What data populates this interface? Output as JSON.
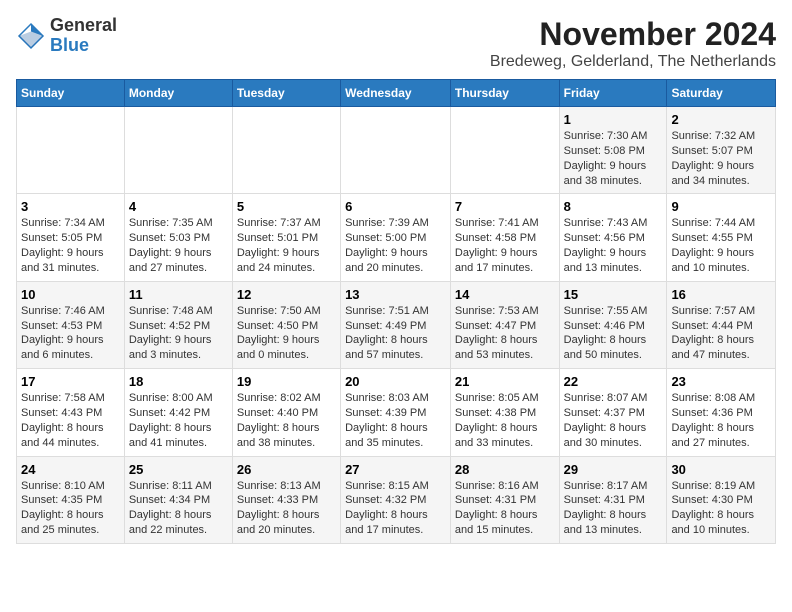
{
  "logo": {
    "general": "General",
    "blue": "Blue"
  },
  "title": "November 2024",
  "location": "Bredeweg, Gelderland, The Netherlands",
  "days_header": [
    "Sunday",
    "Monday",
    "Tuesday",
    "Wednesday",
    "Thursday",
    "Friday",
    "Saturday"
  ],
  "weeks": [
    [
      {
        "day": "",
        "info": ""
      },
      {
        "day": "",
        "info": ""
      },
      {
        "day": "",
        "info": ""
      },
      {
        "day": "",
        "info": ""
      },
      {
        "day": "",
        "info": ""
      },
      {
        "day": "1",
        "info": "Sunrise: 7:30 AM\nSunset: 5:08 PM\nDaylight: 9 hours and 38 minutes."
      },
      {
        "day": "2",
        "info": "Sunrise: 7:32 AM\nSunset: 5:07 PM\nDaylight: 9 hours and 34 minutes."
      }
    ],
    [
      {
        "day": "3",
        "info": "Sunrise: 7:34 AM\nSunset: 5:05 PM\nDaylight: 9 hours and 31 minutes."
      },
      {
        "day": "4",
        "info": "Sunrise: 7:35 AM\nSunset: 5:03 PM\nDaylight: 9 hours and 27 minutes."
      },
      {
        "day": "5",
        "info": "Sunrise: 7:37 AM\nSunset: 5:01 PM\nDaylight: 9 hours and 24 minutes."
      },
      {
        "day": "6",
        "info": "Sunrise: 7:39 AM\nSunset: 5:00 PM\nDaylight: 9 hours and 20 minutes."
      },
      {
        "day": "7",
        "info": "Sunrise: 7:41 AM\nSunset: 4:58 PM\nDaylight: 9 hours and 17 minutes."
      },
      {
        "day": "8",
        "info": "Sunrise: 7:43 AM\nSunset: 4:56 PM\nDaylight: 9 hours and 13 minutes."
      },
      {
        "day": "9",
        "info": "Sunrise: 7:44 AM\nSunset: 4:55 PM\nDaylight: 9 hours and 10 minutes."
      }
    ],
    [
      {
        "day": "10",
        "info": "Sunrise: 7:46 AM\nSunset: 4:53 PM\nDaylight: 9 hours and 6 minutes."
      },
      {
        "day": "11",
        "info": "Sunrise: 7:48 AM\nSunset: 4:52 PM\nDaylight: 9 hours and 3 minutes."
      },
      {
        "day": "12",
        "info": "Sunrise: 7:50 AM\nSunset: 4:50 PM\nDaylight: 9 hours and 0 minutes."
      },
      {
        "day": "13",
        "info": "Sunrise: 7:51 AM\nSunset: 4:49 PM\nDaylight: 8 hours and 57 minutes."
      },
      {
        "day": "14",
        "info": "Sunrise: 7:53 AM\nSunset: 4:47 PM\nDaylight: 8 hours and 53 minutes."
      },
      {
        "day": "15",
        "info": "Sunrise: 7:55 AM\nSunset: 4:46 PM\nDaylight: 8 hours and 50 minutes."
      },
      {
        "day": "16",
        "info": "Sunrise: 7:57 AM\nSunset: 4:44 PM\nDaylight: 8 hours and 47 minutes."
      }
    ],
    [
      {
        "day": "17",
        "info": "Sunrise: 7:58 AM\nSunset: 4:43 PM\nDaylight: 8 hours and 44 minutes."
      },
      {
        "day": "18",
        "info": "Sunrise: 8:00 AM\nSunset: 4:42 PM\nDaylight: 8 hours and 41 minutes."
      },
      {
        "day": "19",
        "info": "Sunrise: 8:02 AM\nSunset: 4:40 PM\nDaylight: 8 hours and 38 minutes."
      },
      {
        "day": "20",
        "info": "Sunrise: 8:03 AM\nSunset: 4:39 PM\nDaylight: 8 hours and 35 minutes."
      },
      {
        "day": "21",
        "info": "Sunrise: 8:05 AM\nSunset: 4:38 PM\nDaylight: 8 hours and 33 minutes."
      },
      {
        "day": "22",
        "info": "Sunrise: 8:07 AM\nSunset: 4:37 PM\nDaylight: 8 hours and 30 minutes."
      },
      {
        "day": "23",
        "info": "Sunrise: 8:08 AM\nSunset: 4:36 PM\nDaylight: 8 hours and 27 minutes."
      }
    ],
    [
      {
        "day": "24",
        "info": "Sunrise: 8:10 AM\nSunset: 4:35 PM\nDaylight: 8 hours and 25 minutes."
      },
      {
        "day": "25",
        "info": "Sunrise: 8:11 AM\nSunset: 4:34 PM\nDaylight: 8 hours and 22 minutes."
      },
      {
        "day": "26",
        "info": "Sunrise: 8:13 AM\nSunset: 4:33 PM\nDaylight: 8 hours and 20 minutes."
      },
      {
        "day": "27",
        "info": "Sunrise: 8:15 AM\nSunset: 4:32 PM\nDaylight: 8 hours and 17 minutes."
      },
      {
        "day": "28",
        "info": "Sunrise: 8:16 AM\nSunset: 4:31 PM\nDaylight: 8 hours and 15 minutes."
      },
      {
        "day": "29",
        "info": "Sunrise: 8:17 AM\nSunset: 4:31 PM\nDaylight: 8 hours and 13 minutes."
      },
      {
        "day": "30",
        "info": "Sunrise: 8:19 AM\nSunset: 4:30 PM\nDaylight: 8 hours and 10 minutes."
      }
    ]
  ]
}
